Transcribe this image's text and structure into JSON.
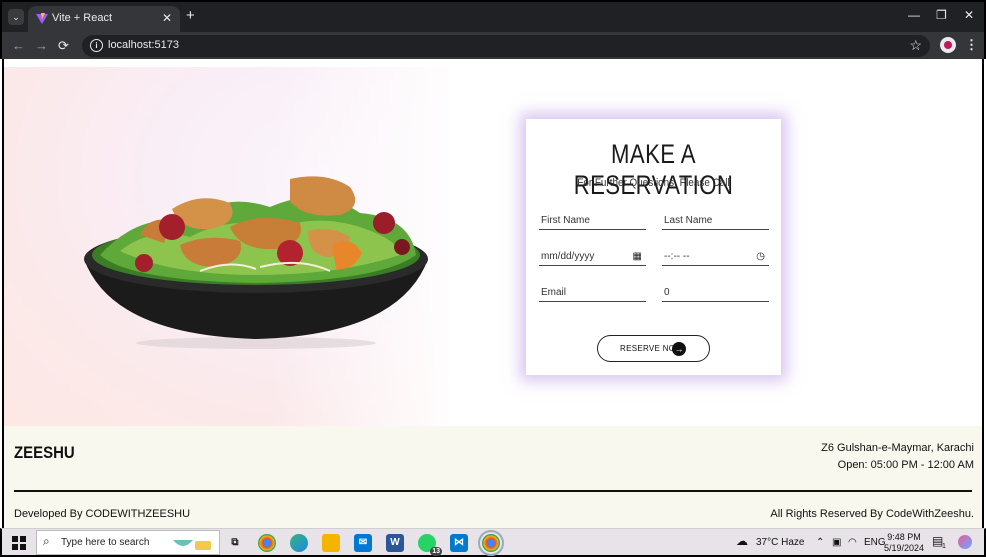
{
  "browser": {
    "tab_title": "Vite + React",
    "tab_close": "✕",
    "new_tab": "+",
    "url": "localhost:5173",
    "window_controls": {
      "minimize": "—",
      "maximize": "❐",
      "close": "✕"
    },
    "nav": {
      "back": "←",
      "forward": "→",
      "reload": "⟳"
    }
  },
  "reservation": {
    "title": "MAKE A RESERVATION",
    "subtitle": "For Further Questions, Please Call",
    "first_name_placeholder": "First Name",
    "last_name_placeholder": "Last Name",
    "date_placeholder": "mm/dd/yyyy",
    "time_placeholder": "--:-- --",
    "email_placeholder": "Email",
    "phone_value": "0",
    "button_label": "RESERVE NOW"
  },
  "footer": {
    "brand": "ZEESHU",
    "address": "Z6 Gulshan-e-Maymar, Karachi",
    "hours": "Open: 05:00 PM - 12:00 AM",
    "developed_by": "Developed By CODEWITHZEESHU",
    "rights": "All Rights Reserved By CodeWithZeeshu."
  },
  "taskbar": {
    "search_placeholder": "Type here to search",
    "weather": "37°C  Haze",
    "language": "ENG",
    "time": "9:48 PM",
    "date": "5/19/2024",
    "whatsapp_badge": "13",
    "notification_badge": "1"
  },
  "colors": {
    "card_glow": "#ba96e6",
    "footer_bg": "#f8f8ee",
    "chrome_dark": "#202124"
  }
}
